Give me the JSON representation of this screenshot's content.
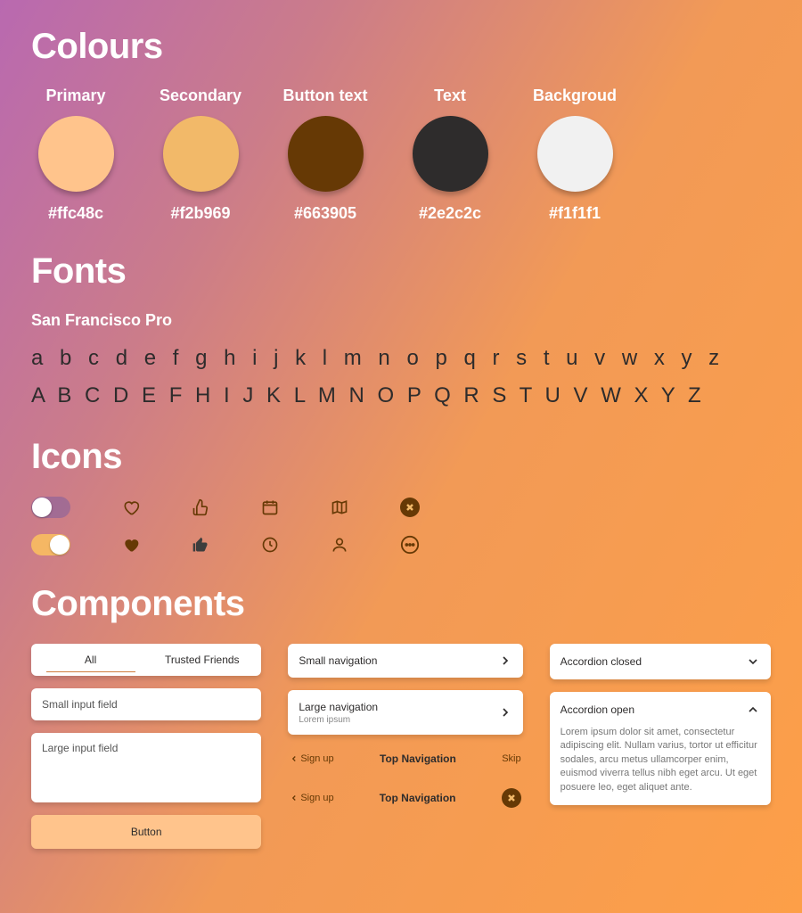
{
  "colours": {
    "heading": "Colours",
    "items": [
      {
        "label": "Primary",
        "hex": "#ffc48c"
      },
      {
        "label": "Secondary",
        "hex": "#f2b969"
      },
      {
        "label": "Button text",
        "hex": "#663905"
      },
      {
        "label": "Text",
        "hex": "#2e2c2c"
      },
      {
        "label": "Backgroud",
        "hex": "#f1f1f1"
      }
    ]
  },
  "fonts": {
    "heading": "Fonts",
    "name": "San Francisco Pro",
    "lower": "a b c d e f g h i j k l m n o p q r s t u v w x y z",
    "upper": "A B C D E F  H I J K L M N O P Q R S T U V W X Y Z"
  },
  "icons": {
    "heading": "Icons"
  },
  "components": {
    "heading": "Components",
    "segmented": {
      "a": "All",
      "b": "Trusted Friends"
    },
    "small_input": "Small input field",
    "large_input": "Large input field",
    "button": "Button",
    "small_nav": "Small navigation",
    "large_nav": {
      "title": "Large navigation",
      "sub": "Lorem ipsum"
    },
    "topnav1": {
      "back": "Sign up",
      "title": "Top Navigation",
      "right": "Skip"
    },
    "topnav2": {
      "back": "Sign up",
      "title": "Top Navigation"
    },
    "acc_closed": "Accordion closed",
    "acc_open": {
      "title": "Accordion open",
      "body": "Lorem ipsum dolor sit amet, consectetur adipiscing elit. Nullam varius, tortor ut efficitur sodales, arcu metus ullamcorper enim, euismod viverra tellus nibh eget arcu. Ut eget posuere leo, eget aliquet ante."
    }
  }
}
